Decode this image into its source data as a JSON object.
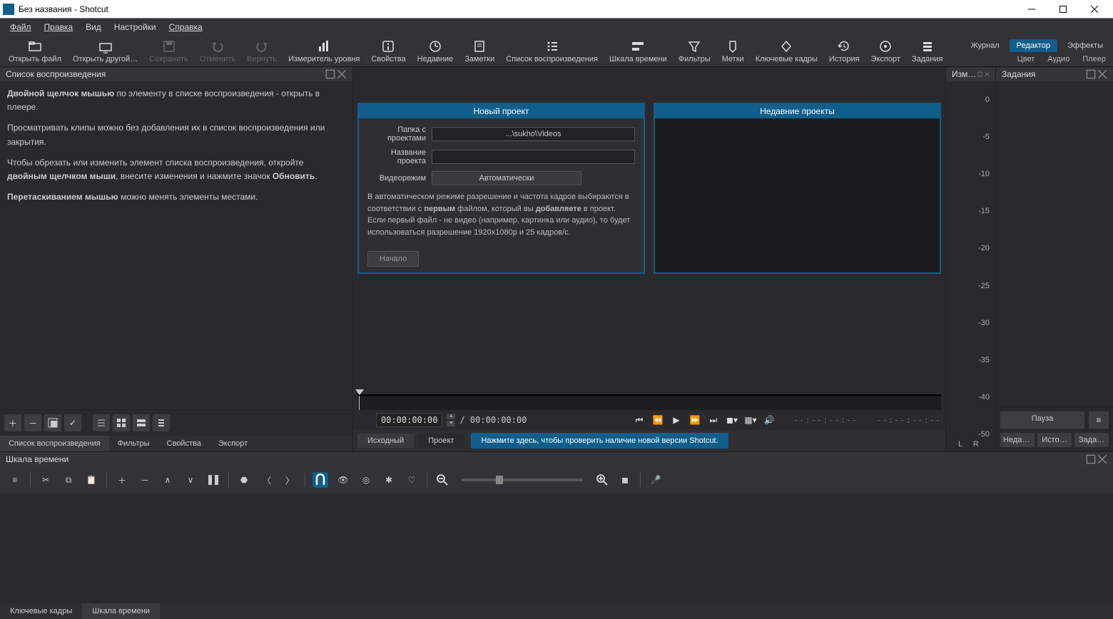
{
  "window": {
    "title": "Без названия - Shotcut"
  },
  "menubar": [
    "Файл",
    "Правка",
    "Вид",
    "Настройки",
    "Справка"
  ],
  "toolbar": [
    {
      "id": "open-file",
      "label": "Открыть файл",
      "icon": "folder"
    },
    {
      "id": "open-other",
      "label": "Открыть другой…",
      "icon": "folder-arrow"
    },
    {
      "id": "save",
      "label": "Сохранить",
      "icon": "save",
      "disabled": true
    },
    {
      "id": "undo",
      "label": "Отменить",
      "icon": "undo",
      "disabled": true
    },
    {
      "id": "redo",
      "label": "Вернуть",
      "icon": "redo",
      "disabled": true
    },
    {
      "id": "level-meter",
      "label": "Измеритель уровня",
      "icon": "bars"
    },
    {
      "id": "properties",
      "label": "Свойства",
      "icon": "info"
    },
    {
      "id": "recent",
      "label": "Недавние",
      "icon": "clock"
    },
    {
      "id": "notes",
      "label": "Заметки",
      "icon": "note"
    },
    {
      "id": "playlist",
      "label": "Список воспроизведения",
      "icon": "list"
    },
    {
      "id": "timeline",
      "label": "Шкала времени",
      "icon": "timeline"
    },
    {
      "id": "filters",
      "label": "Фильтры",
      "icon": "funnel"
    },
    {
      "id": "markers",
      "label": "Метки",
      "icon": "marker"
    },
    {
      "id": "keyframes",
      "label": "Ключевые кадры",
      "icon": "diamond"
    },
    {
      "id": "history",
      "label": "История",
      "icon": "history"
    },
    {
      "id": "export",
      "label": "Экспорт",
      "icon": "disc"
    },
    {
      "id": "jobs",
      "label": "Задания",
      "icon": "stack"
    }
  ],
  "workspace_tabs": {
    "items": [
      "Журнал",
      "Редактор",
      "Эффекты"
    ],
    "active": "Редактор"
  },
  "small_tabs": [
    "Цвет",
    "Аудио",
    "Плеер"
  ],
  "playlist_panel": {
    "title": "Список воспроизведения",
    "p1a": "Двойной щелчок мышью",
    "p1b": " по элементу в списке воспроизведения - открыть в плеере.",
    "p2": "Просматривать клипы можно без добавления их в список воспроизведения или закрытия.",
    "p3a": "Чтобы обрезать или изменить элемент списка воспроизведения, откройте ",
    "p3b": "двойным щелчком мыши",
    "p3c": ", внесите изменения и нажмите значок ",
    "p3d": "Обновить",
    "p3e": ".",
    "p4a": "Перетаскиванием мышью",
    "p4b": " можно менять элементы местами.",
    "view_icons": [
      "plus",
      "minus",
      "overlay",
      "check",
      "list-detail",
      "grid",
      "tiles",
      "list-simple"
    ],
    "tabs": [
      "Список воспроизведения",
      "Фильтры",
      "Свойства",
      "Экспорт"
    ],
    "active_tab": "Список воспроизведения"
  },
  "project": {
    "new_title": "Новый проект",
    "recent_title": "Недавние проекты",
    "folder_label": "Папка с проектами",
    "folder_value": "...\\sukho\\Videos",
    "name_label": "Название проекта",
    "name_value": "",
    "mode_label": "Видеорежим",
    "mode_value": "Автоматически",
    "desc_a": "В автоматическом режиме разрешение и частота кадров выбираются в соответствии с ",
    "desc_b": "первым",
    "desc_c": " файлом, который вы ",
    "desc_d": "добавляете",
    "desc_e": " в проект. Если первый файл - не видео (например, картинка или аудио), то будет использоваться разрешение 1920x1080p и 25 кадров/с.",
    "start": "Начало"
  },
  "transport": {
    "tc_in": "00:00:00:00",
    "tc_total": "/ 00:00:00:00",
    "tc_r1": "--:--:--:--",
    "tc_r2": "--:--:--:--"
  },
  "center_tabs": {
    "items": [
      "Исходный",
      "Проект"
    ],
    "active": "Проект"
  },
  "update_banner": "Нажмите здесь, чтобы проверить наличие новой версии Shotcut.",
  "meter": {
    "title": "Изм…",
    "ticks": [
      "0",
      "-5",
      "-10",
      "-15",
      "-20",
      "-25",
      "-30",
      "-35",
      "-40",
      "-50"
    ],
    "lr": "L   R"
  },
  "tasks": {
    "title": "Задания",
    "pause": "Пауза",
    "menu": "≡",
    "bottom_tabs": [
      "Недавн…",
      "Исто…",
      "Зада…"
    ]
  },
  "timeline": {
    "title": "Шкала времени",
    "tabs": [
      "Ключевые кадры",
      "Шкала времени"
    ],
    "active_tab": "Шкала времени"
  }
}
